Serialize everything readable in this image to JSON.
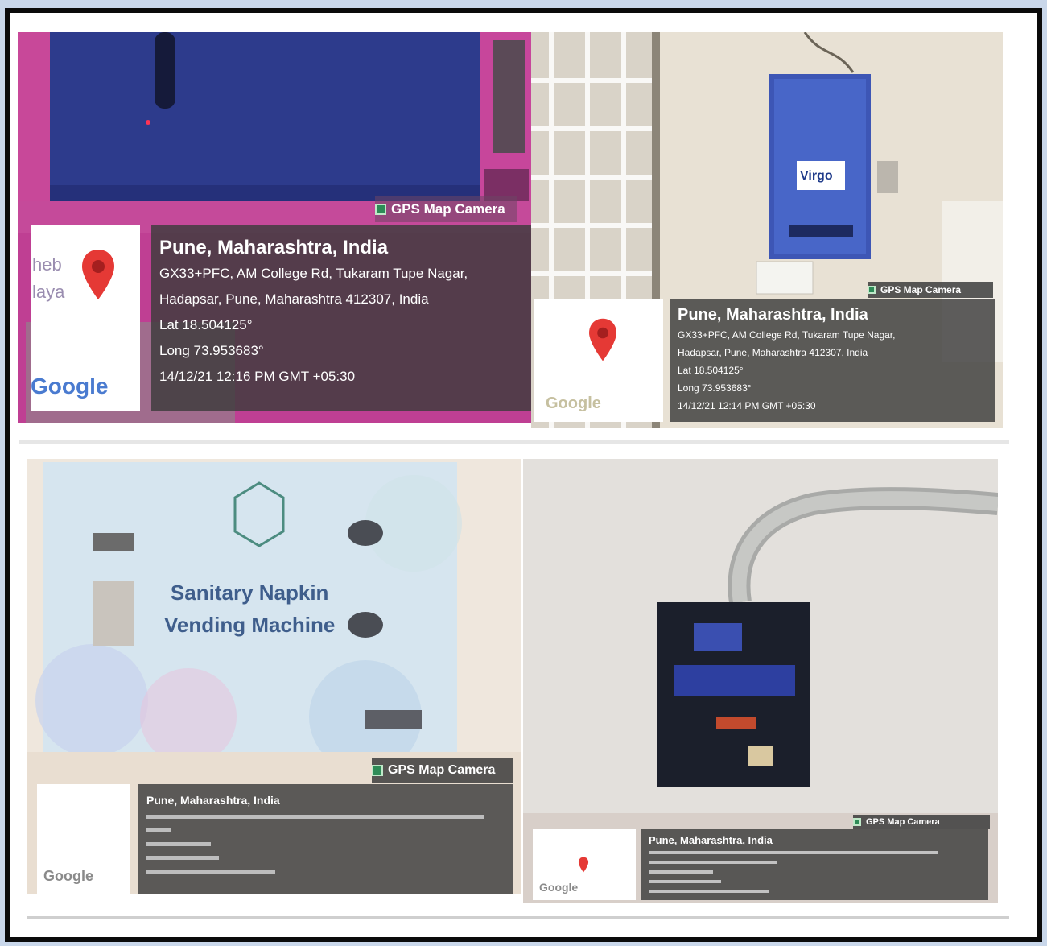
{
  "panels": [
    {
      "camera_label": "GPS Map Camera",
      "place": "Pune, Maharashtra, India",
      "address_line1": "GX33+PFC, AM College Rd, Tukaram Tupe Nagar,",
      "address_line2": "Hadapsar, Pune, Maharashtra 412307, India",
      "lat": "Lat 18.504125°",
      "long": "Long 73.953683°",
      "timestamp": "14/12/21 12:16 PM GMT +05:30",
      "map_text_1": "heb",
      "map_text_2": "laya",
      "google": "Google"
    },
    {
      "camera_label": "GPS Map Camera",
      "place": "Pune, Maharashtra, India",
      "address_line1": "GX33+PFC, AM College Rd, Tukaram Tupe Nagar,",
      "address_line2": "Hadapsar, Pune, Maharashtra 412307, India",
      "lat": "Lat 18.504125°",
      "long": "Long 73.953683°",
      "timestamp": "14/12/21 12:14 PM GMT +05:30",
      "device_brand": "Virgo",
      "google": "Google"
    },
    {
      "camera_label": "GPS Map Camera",
      "place": "Pune, Maharashtra, India",
      "machine_title_1": "Sanitary Napkin",
      "machine_title_2": "Vending Machine",
      "google": "Google"
    },
    {
      "camera_label": "GPS Map Camera",
      "place": "Pune, Maharashtra, India",
      "google": "Google"
    }
  ],
  "colors": {
    "gps_overlay": "#3c3c3c",
    "pin_red": "#e53935",
    "machine_pink": "#c2408f",
    "machine_blue": "#2b3a8f",
    "wall": "#e9e2d6"
  }
}
